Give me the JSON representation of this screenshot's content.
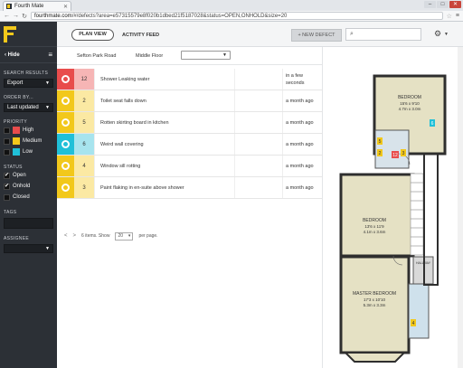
{
  "browser": {
    "tab_title": "Fourth Mate",
    "url_host": "fourthmate.com",
    "url_path": "/#/defects?area=e57315579e8f020b1dbed21f5187028&status=OPEN,ONHOLD&size=20",
    "window_buttons": [
      "–",
      "□",
      "✕"
    ]
  },
  "sidebar": {
    "hide_label": "Hide",
    "search_results_label": "SEARCH RESULTS",
    "export_label": "Export",
    "order_label": "ORDER BY...",
    "order_value": "Last updated",
    "priority_label": "PRIORITY",
    "priorities": [
      {
        "label": "High",
        "color": "#e84c4c"
      },
      {
        "label": "Medium",
        "color": "#f2c81b"
      },
      {
        "label": "Low",
        "color": "#20c0d8"
      }
    ],
    "status_label": "STATUS",
    "statuses": [
      {
        "label": "Open",
        "checked": true,
        "mark": "✔"
      },
      {
        "label": "Onhold",
        "checked": true,
        "mark": "✔"
      },
      {
        "label": "Closed",
        "checked": false,
        "mark": ""
      }
    ],
    "tags_label": "TAGS",
    "assignee_label": "ASSIGNEE"
  },
  "toolbar": {
    "plan_view": "PLAN VIEW",
    "activity_feed": "ACTIVITY FEED",
    "new_defect": "+ NEW DEFECT",
    "search_placeholder": ""
  },
  "filters": {
    "crumb1": "Sefton Park Road",
    "crumb2": "Middle Floor"
  },
  "defects": [
    {
      "priority": "high",
      "color": "#e84c4c",
      "tint": "#f6b5b5",
      "number": "12",
      "title": "Shower Leaking water",
      "date": "in a few seconds"
    },
    {
      "priority": "medium",
      "color": "#f2c81b",
      "tint": "#fbe9a3",
      "number": "2",
      "title": "Toilet seat falls down",
      "date": "a month ago"
    },
    {
      "priority": "medium",
      "color": "#f2c81b",
      "tint": "#fbe9a3",
      "number": "5",
      "title": "Rotten skirting board in kitchen",
      "date": "a month ago"
    },
    {
      "priority": "low",
      "color": "#20c0d8",
      "tint": "#a7e4ee",
      "number": "6",
      "title": "Weird wall covering",
      "date": "a month ago"
    },
    {
      "priority": "medium",
      "color": "#f2c81b",
      "tint": "#fbe9a3",
      "number": "4",
      "title": "Window sill rotting",
      "date": "a month ago"
    },
    {
      "priority": "medium",
      "color": "#f2c81b",
      "tint": "#fbe9a3",
      "number": "3",
      "title": "Paint flaking in en-suite above shower",
      "date": "a month ago"
    }
  ],
  "pager": {
    "prev": "<",
    "next": ">",
    "summary": "6 items. Show",
    "page_size": "20",
    "per_page": "per page."
  },
  "floorplan": {
    "rooms": [
      {
        "name": "BEDROOM",
        "dims1": "15'6 x 9'10",
        "dims2": "4.7m x 3.0m"
      },
      {
        "name": "BEDROOM",
        "dims1": "13'6 x 11'9",
        "dims2": "4.1m x 3.6m"
      },
      {
        "name": "MASTER BEDROOM",
        "dims1": "17'3 x 10'10",
        "dims2": "5.3m x 3.3m"
      },
      {
        "name": "HALLWAY"
      }
    ],
    "pins": [
      {
        "number": "5",
        "color": "#f2c81b"
      },
      {
        "number": "6",
        "color": "#20c0d8"
      },
      {
        "number": "2",
        "color": "#f2c81b"
      },
      {
        "number": "12",
        "color": "#e84c4c"
      },
      {
        "number": "3",
        "color": "#f2c81b"
      },
      {
        "number": "4",
        "color": "#f2c81b"
      }
    ]
  }
}
